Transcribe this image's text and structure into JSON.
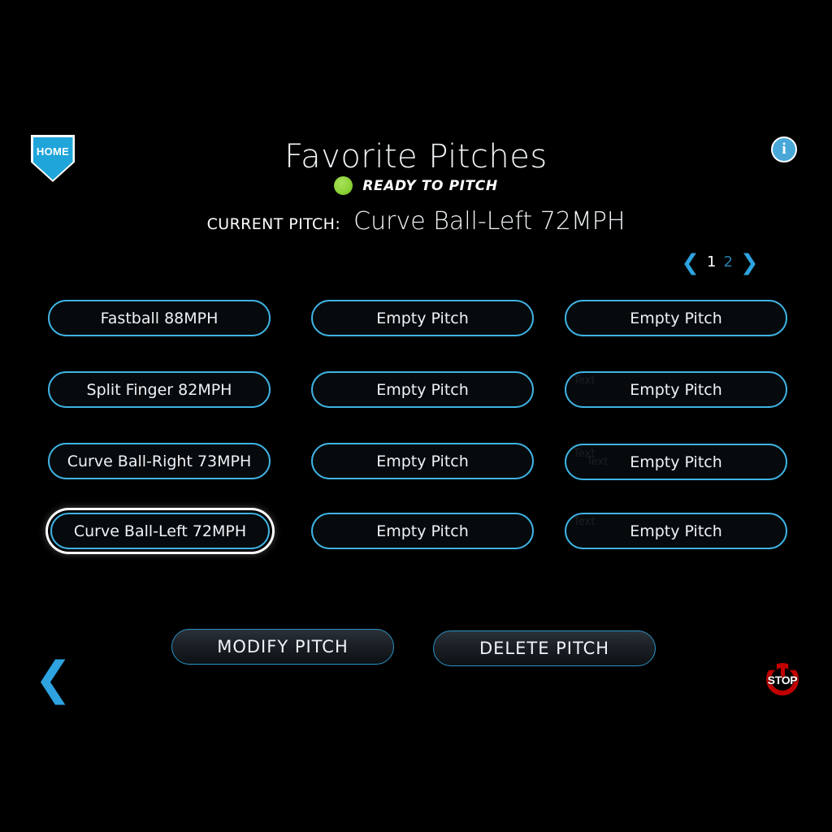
{
  "header": {
    "title": "Favorite Pitches",
    "home_label": "HOME",
    "home_icon": "home-plate-icon",
    "info_icon": "info-icon",
    "info_glyph": "i"
  },
  "status": {
    "text": "READY TO PITCH",
    "dot_color": "#8ed338"
  },
  "current_pitch": {
    "label": "CURRENT PITCH:",
    "value": "Curve Ball-Left 72MPH"
  },
  "pagination": {
    "prev_icon": "chevron-left-icon",
    "next_icon": "chevron-right-icon",
    "prev_glyph": "❮",
    "next_glyph": "❯",
    "pages": [
      "1",
      "2"
    ],
    "active_page": "1"
  },
  "pitch_grid": {
    "columns": 3,
    "rows": 4,
    "empty_label": "Empty Pitch",
    "selected_index": 9,
    "ghost_artifact_text": "Text",
    "buttons": [
      {
        "label": "Fastball 88MPH",
        "empty": false,
        "selected": false
      },
      {
        "label": "Empty Pitch",
        "empty": true,
        "selected": false
      },
      {
        "label": "Empty Pitch",
        "empty": true,
        "selected": false
      },
      {
        "label": "Split Finger 82MPH",
        "empty": false,
        "selected": false
      },
      {
        "label": "Empty Pitch",
        "empty": true,
        "selected": false
      },
      {
        "label": "Empty Pitch",
        "empty": true,
        "selected": false
      },
      {
        "label": "Curve Ball-Right 73MPH",
        "empty": false,
        "selected": false
      },
      {
        "label": "Empty Pitch",
        "empty": true,
        "selected": false
      },
      {
        "label": "Empty Pitch",
        "empty": true,
        "selected": false
      },
      {
        "label": "Curve Ball-Left 72MPH",
        "empty": false,
        "selected": true
      },
      {
        "label": "Empty Pitch",
        "empty": true,
        "selected": false
      },
      {
        "label": "Empty Pitch",
        "empty": true,
        "selected": false
      }
    ]
  },
  "actions": {
    "modify_label": "MODIFY PITCH",
    "delete_label": "DELETE PITCH"
  },
  "footer": {
    "back_icon": "chevron-left-icon",
    "back_glyph": "❮",
    "stop_icon": "power-stop-icon",
    "stop_label": "STOP"
  },
  "theme": {
    "background": "#000000",
    "accent": "#3fb3e3",
    "text": "#f2f6f9",
    "stop_red": "#c20000"
  }
}
